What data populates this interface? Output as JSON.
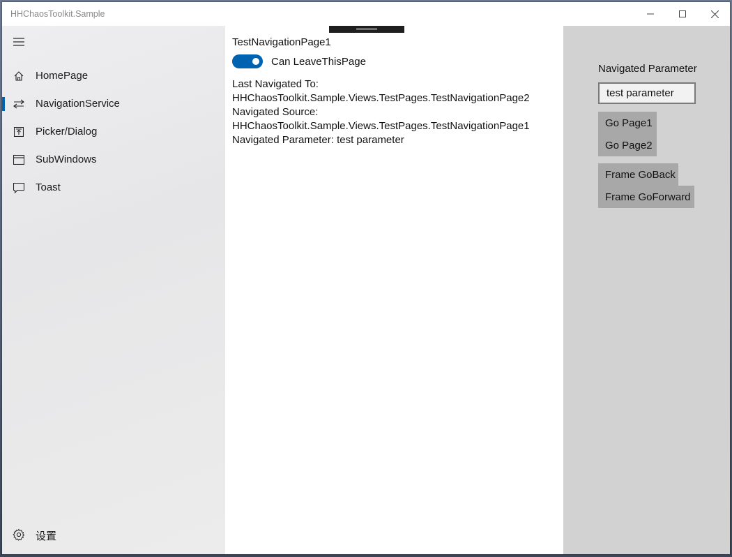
{
  "window": {
    "title": "HHChaosToolkit.Sample"
  },
  "nav": {
    "items": [
      {
        "label": "HomePage",
        "icon": "home-icon"
      },
      {
        "label": "NavigationService",
        "icon": "arrows-swap-icon",
        "selected": true
      },
      {
        "label": "Picker/Dialog",
        "icon": "picker-icon"
      },
      {
        "label": "SubWindows",
        "icon": "window-icon"
      },
      {
        "label": "Toast",
        "icon": "chat-bubble-icon"
      }
    ],
    "settings_label": "设置",
    "accent_color": "#0063b1"
  },
  "content": {
    "page_title": "TestNavigationPage1",
    "toggle": {
      "label": "Can LeaveThisPage",
      "on": true
    },
    "last_navigated_label": "Last Navigated To:",
    "last_navigated_value": "HHChaosToolkit.Sample.Views.TestPages.TestNavigationPage2",
    "navigated_source_label": "Navigated Source:",
    "navigated_source_value": "HHChaosToolkit.Sample.Views.TestPages.TestNavigationPage1",
    "navigated_parameter_line": "Navigated Parameter: test parameter"
  },
  "side": {
    "parameter_label": "Navigated Parameter",
    "parameter_value": "test parameter",
    "go_page1": "Go Page1",
    "go_page2": "Go Page2",
    "frame_goback": "Frame GoBack",
    "frame_goforward": "Frame GoForward"
  }
}
